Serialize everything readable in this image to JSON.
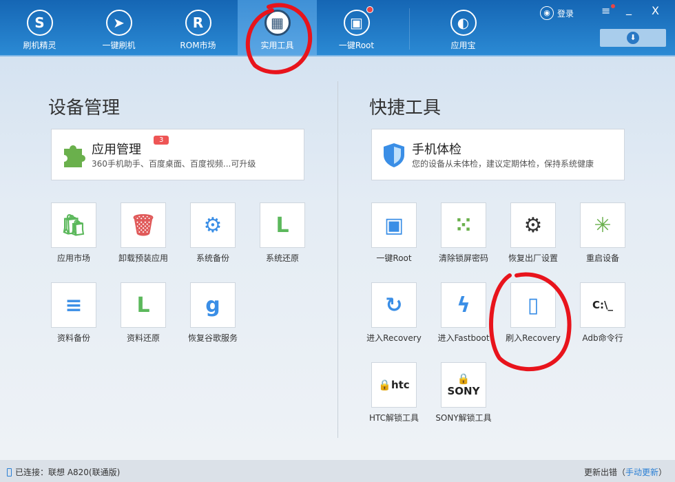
{
  "nav": {
    "tabs": [
      {
        "label": "刷机精灵",
        "icon": "shield-s-icon",
        "glyph": "S"
      },
      {
        "label": "一键刷机",
        "icon": "cursor-icon",
        "glyph": "➤"
      },
      {
        "label": "ROM市场",
        "icon": "rom-r-icon",
        "glyph": "R"
      },
      {
        "label": "实用工具",
        "icon": "grid-icon",
        "glyph": "▦",
        "active": true
      },
      {
        "label": "一键Root",
        "icon": "android-icon",
        "glyph": "▣",
        "notification": true
      },
      {
        "label": "应用宝",
        "icon": "yingyongbao-icon",
        "glyph": "◐"
      }
    ],
    "login": "登录",
    "menu": "≡",
    "minimize": "_",
    "close": "X",
    "download": "⬇"
  },
  "left": {
    "title": "设备管理",
    "card": {
      "title": "应用管理",
      "badge": "3",
      "subtitle": "360手机助手、百度桌面、百度视频...可升级"
    },
    "tools": [
      {
        "label": "应用市场",
        "glyph": "🛍",
        "color": "#5cb85c"
      },
      {
        "label": "卸载预装应用",
        "glyph": "🗑",
        "color": "#e05a5a"
      },
      {
        "label": "系统备份",
        "glyph": "⚙",
        "color": "#3a8ee6"
      },
      {
        "label": "系统还原",
        "glyph": "L",
        "color": "#5cb85c"
      },
      {
        "label": "资料备份",
        "glyph": "≡",
        "color": "#3a8ee6"
      },
      {
        "label": "资料还原",
        "glyph": "L",
        "color": "#5cb85c"
      },
      {
        "label": "恢复谷歌服务",
        "glyph": "g",
        "color": "#3a8ee6"
      }
    ]
  },
  "right": {
    "title": "快捷工具",
    "card": {
      "title": "手机体检",
      "subtitle": "您的设备从未体检，建议定期体检，保持系统健康"
    },
    "tools": [
      {
        "label": "一键Root",
        "glyph": "▣",
        "color": "#3a8ee6"
      },
      {
        "label": "清除锁屏密码",
        "glyph": "⁙",
        "color": "#6ab04c"
      },
      {
        "label": "恢复出厂设置",
        "glyph": "⚙",
        "color": "#333"
      },
      {
        "label": "重启设备",
        "glyph": "✳",
        "color": "#6ab04c"
      },
      {
        "label": "进入Recovery",
        "glyph": "↻",
        "color": "#3a8ee6"
      },
      {
        "label": "进入Fastboot",
        "glyph": "ϟ",
        "color": "#3a8ee6"
      },
      {
        "label": "刷入Recovery",
        "glyph": "▯",
        "color": "#3a8ee6"
      },
      {
        "label": "Adb命令行",
        "glyph": "C:\\_",
        "color": "#222"
      },
      {
        "label": "HTC解锁工具",
        "glyph": "🔒htc",
        "color": "#222"
      },
      {
        "label": "SONY解锁工具",
        "glyph": "🔒SONY",
        "color": "#222"
      }
    ]
  },
  "status": {
    "connected": "已连接：联想 A820(联通版)",
    "update_error": "更新出错（",
    "manual_update": "手动更新",
    "close_paren": "）"
  }
}
